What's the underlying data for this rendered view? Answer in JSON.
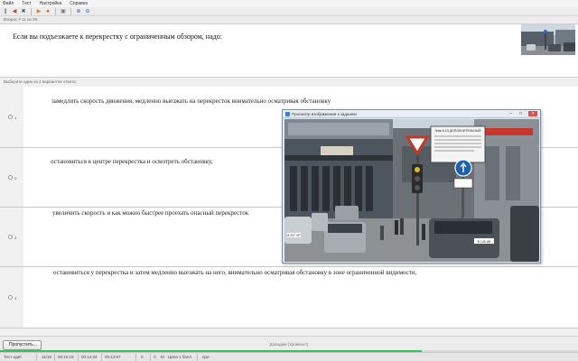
{
  "menu": [
    "Файл",
    "Тест",
    "Настройка",
    "Справка"
  ],
  "question_info": "Вопрос # 11 из 29.",
  "question_text": "Если вы подъезжаете к перекрестку с ограниченным обзором, надо:",
  "answer_hint": "Выберите один из 4 вариантов ответа:",
  "answers": [
    {
      "number": "1",
      "text": "замедлить скорость движения, медленно выезжать на перекресток внимательно осматривая обстановку"
    },
    {
      "number": "2",
      "text": "остановиться в центре перекрестка и осмотреть обстановку,"
    },
    {
      "number": "3",
      "text": "увеличить скорость и как можно быстрее проехать опасный перекресток"
    },
    {
      "number": "4",
      "text": "остановиться у перекрестка и затем медленно выезжать на него, внимательно осматривая обстановку в зоне ограниченной видимости,"
    }
  ],
  "viewer": {
    "title": "Просмотр изображения к заданию",
    "sign_text": "Знак 8.13 ДОПОЛНИТЕЛЬНЫЙ",
    "plate_1": "M 237 ХР",
    "plate_2": "B 145 АВ"
  },
  "bottom": {
    "skip_label": "Пропустить...",
    "level_label": "Доводим (Уровень?)",
    "progress": 0.73
  },
  "status": [
    "Тест идет",
    "11/15",
    "00:10:23",
    "00:14:34",
    "00:13:57",
    "0",
    "С",
    "М",
    "Цена 1 балл",
    "при"
  ],
  "colors": {
    "progress": "#35c25a",
    "close_button": "#d9534f"
  }
}
